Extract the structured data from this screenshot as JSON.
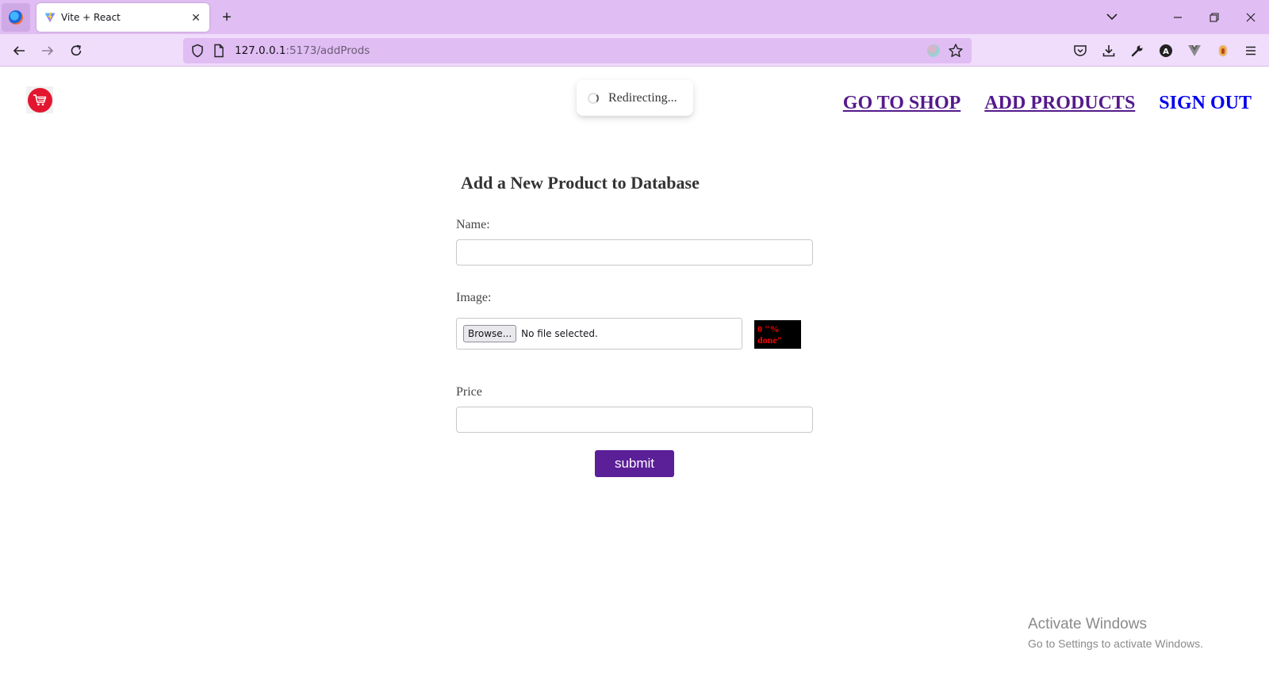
{
  "browser": {
    "tab_title": "Vite + React",
    "url_host": "127.0.0.1",
    "url_path": ":5173/addProds",
    "accent": "#e0bdf3"
  },
  "toast": {
    "text": "Redirecting..."
  },
  "nav": {
    "go_to_shop": "GO TO SHOP",
    "add_products": "ADD PRODUCTS",
    "sign_out": "SIGN OUT"
  },
  "form": {
    "title": "Add a New Product to Database",
    "name_label": "Name:",
    "name_value": "",
    "image_label": "Image:",
    "browse_label": "Browse...",
    "file_status": "No file selected.",
    "progress_text": "0 \"% done\"",
    "price_label": "Price",
    "price_value": "",
    "submit_label": "submit",
    "submit_color": "#5b1f98"
  },
  "os_watermark": {
    "title": "Activate Windows",
    "subtitle": "Go to Settings to activate Windows."
  }
}
